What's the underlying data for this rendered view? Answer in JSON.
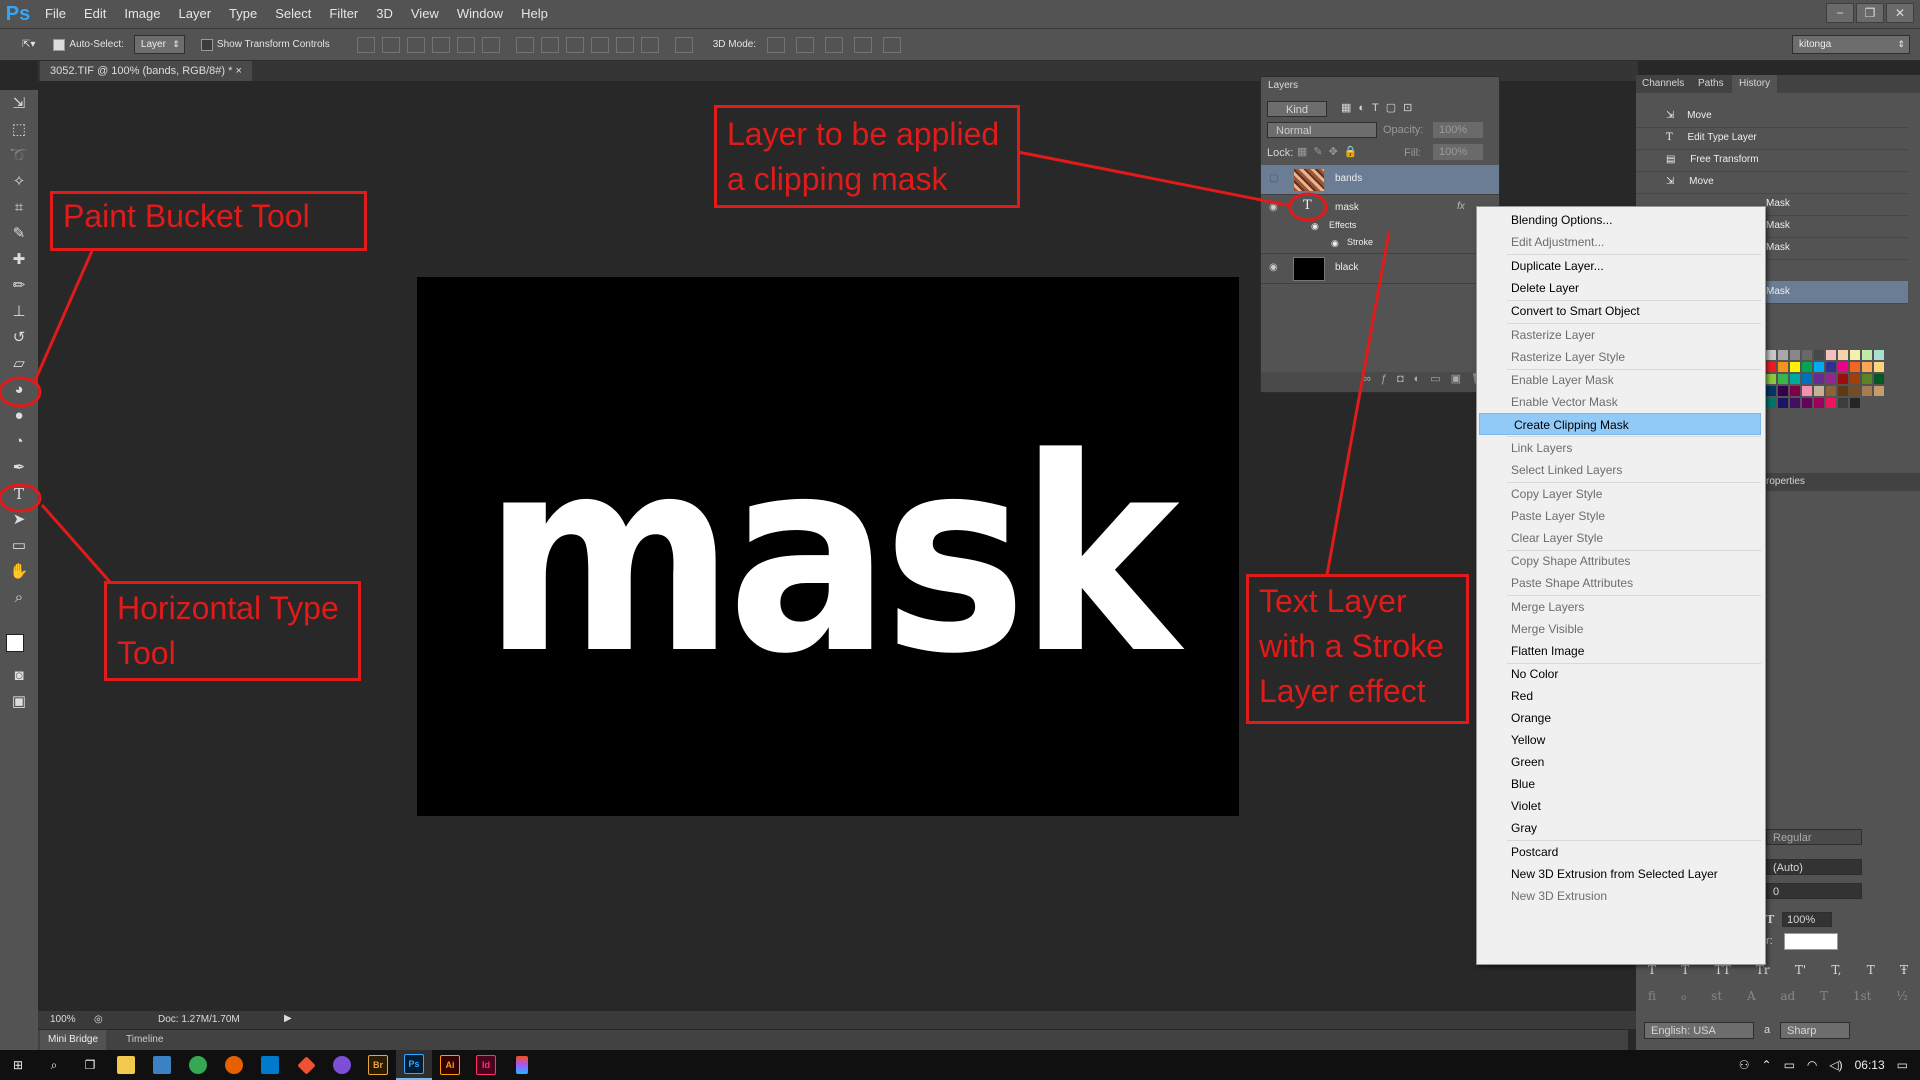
{
  "app": {
    "logo": "Ps",
    "brand_color": "#31a8ff"
  },
  "menubar": {
    "items": [
      "File",
      "Edit",
      "Image",
      "Layer",
      "Type",
      "Select",
      "Filter",
      "3D",
      "View",
      "Window",
      "Help"
    ]
  },
  "window_controls": [
    "−",
    "❐",
    "✕"
  ],
  "options_bar": {
    "auto_select_label": "Auto-Select:",
    "auto_select_target": "Layer",
    "show_transform_label": "Show Transform Controls",
    "mode_3d_label": "3D Mode:",
    "workspace": "kitonga"
  },
  "document": {
    "tab_title": "3052.TIF @ 100% (bands, RGB/8#) *",
    "canvas_text": "mask"
  },
  "status": {
    "zoom": "100%",
    "doc_size": "Doc: 1.27M/1.70M"
  },
  "bottom_tabs": [
    "Mini Bridge",
    "Timeline"
  ],
  "layers_panel": {
    "title": "Layers",
    "filter": "Kind",
    "blend_mode": "Normal",
    "opacity_label": "Opacity:",
    "opacity_value": "100%",
    "lock_label": "Lock:",
    "fill_label": "Fill:",
    "fill_value": "100%",
    "layers": [
      {
        "name": "bands"
      },
      {
        "name": "mask",
        "fx": "fx",
        "effects_label": "Effects",
        "effect": "Stroke"
      },
      {
        "name": "black"
      }
    ]
  },
  "right_panel": {
    "tabs": [
      "Channels",
      "Paths",
      "History"
    ],
    "history": [
      "Move",
      "Edit Type Layer",
      "Free Transform",
      "Move",
      "Mask",
      "Mask",
      "Mask",
      "Mask"
    ],
    "properties_tab": "roperties",
    "char": {
      "style": "Regular",
      "leading": "(Auto)",
      "tracking": "0",
      "scale": "100%",
      "language": "English: USA",
      "antialias": "Sharp",
      "aa_label": "a",
      "color_label": "r:"
    },
    "type_style_buttons": [
      "T",
      "T",
      "TT",
      "Tr",
      "T'",
      "T,",
      "T",
      "Ŧ"
    ],
    "opentype_buttons": [
      "fi",
      "ℴ",
      "st",
      "A",
      "ad",
      "T",
      "1st",
      "½"
    ]
  },
  "swatch_colors": [
    "#c8c8c8",
    "#a8a8a8",
    "#888",
    "#686868",
    "#484848",
    "#f3c0c0",
    "#f5d2a8",
    "#f4efaa",
    "#c4e8aa",
    "#a8e0d0",
    "#ed1c24",
    "#f7941d",
    "#fff200",
    "#00a651",
    "#00aeef",
    "#2e3192",
    "#ec008c",
    "#f26522",
    "#f9a65a",
    "#fdd37c",
    "#8dc63f",
    "#39b54a",
    "#00a99d",
    "#0072bc",
    "#662d91",
    "#92278f",
    "#9e0b0f",
    "#a0410d",
    "#598527",
    "#005826",
    "#003663",
    "#32004b",
    "#7b0046",
    "#f48fb1",
    "#c7b299",
    "#8c6239",
    "#603913",
    "#754c24",
    "#a67c52",
    "#c69c6d",
    "#00746b",
    "#1b1464",
    "#440e62",
    "#630460",
    "#9e005d",
    "#ed145b",
    "#3c3c3c",
    "#252525"
  ],
  "context_menu": {
    "items": [
      {
        "label": "Blending Options...",
        "disabled": false
      },
      {
        "label": "Edit Adjustment...",
        "disabled": true
      },
      {
        "sep": true
      },
      {
        "label": "Duplicate Layer...",
        "disabled": false
      },
      {
        "label": "Delete Layer",
        "disabled": false
      },
      {
        "sep": true
      },
      {
        "label": "Convert to Smart Object",
        "disabled": false
      },
      {
        "sep": true
      },
      {
        "label": "Rasterize Layer",
        "disabled": true
      },
      {
        "label": "Rasterize Layer Style",
        "disabled": true
      },
      {
        "sep": true
      },
      {
        "label": "Enable Layer Mask",
        "disabled": true
      },
      {
        "label": "Enable Vector Mask",
        "disabled": true
      },
      {
        "label": "Create Clipping Mask",
        "disabled": false,
        "highlighted": true
      },
      {
        "sep": true
      },
      {
        "label": "Link Layers",
        "disabled": true
      },
      {
        "label": "Select Linked Layers",
        "disabled": true
      },
      {
        "sep": true
      },
      {
        "label": "Copy Layer Style",
        "disabled": true
      },
      {
        "label": "Paste Layer Style",
        "disabled": true
      },
      {
        "label": "Clear Layer Style",
        "disabled": true
      },
      {
        "sep": true
      },
      {
        "label": "Copy Shape Attributes",
        "disabled": true
      },
      {
        "label": "Paste Shape Attributes",
        "disabled": true
      },
      {
        "sep": true
      },
      {
        "label": "Merge Layers",
        "disabled": true
      },
      {
        "label": "Merge Visible",
        "disabled": true
      },
      {
        "label": "Flatten Image",
        "disabled": false
      },
      {
        "sep": true
      },
      {
        "label": "No Color",
        "disabled": false
      },
      {
        "label": "Red",
        "disabled": false
      },
      {
        "label": "Orange",
        "disabled": false
      },
      {
        "label": "Yellow",
        "disabled": false
      },
      {
        "label": "Green",
        "disabled": false
      },
      {
        "label": "Blue",
        "disabled": false
      },
      {
        "label": "Violet",
        "disabled": false
      },
      {
        "label": "Gray",
        "disabled": false
      },
      {
        "sep": true
      },
      {
        "label": "Postcard",
        "disabled": false
      },
      {
        "label": "New 3D Extrusion from Selected Layer",
        "disabled": false
      },
      {
        "label": "New 3D Extrusion",
        "disabled": true
      }
    ]
  },
  "annotations": {
    "paint_bucket": "Paint Bucket Tool",
    "clipping_layer_1": "Layer to be applied",
    "clipping_layer_2": "a clipping mask",
    "type_tool_1": "Horizontal Type",
    "type_tool_2": "Tool",
    "text_layer_1": "Text Layer",
    "text_layer_2": "with a Stroke",
    "text_layer_3": "Layer effect",
    "color": "#e11a1a"
  },
  "taskbar": {
    "time": "06:13",
    "apps": [
      "Br",
      "Ps",
      "Ai",
      "Id"
    ]
  }
}
